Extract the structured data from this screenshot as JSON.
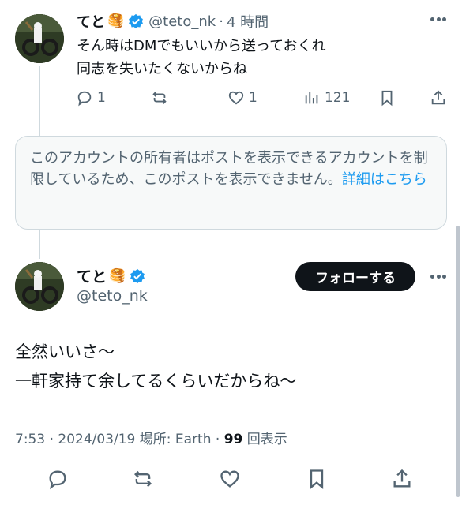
{
  "reply": {
    "name": "てと",
    "emoji": "🥞",
    "handle": "@teto_nk",
    "separator": "·",
    "time": "4 時間",
    "text_line1": "そん時はDMでもいいから送っておくれ",
    "text_line2": "同志を失いたくないからね",
    "reply_count": "1",
    "like_count": "1",
    "view_count": "121"
  },
  "notice": {
    "text": "このアカウントの所有者はポストを表示できるアカウントを制限しているため、このポストを表示できません。",
    "link": "詳細はこちら"
  },
  "main": {
    "name": "てと",
    "emoji": "🥞",
    "handle": "@teto_nk",
    "follow_label": "フォローする",
    "text_line1": "全然いいさ〜",
    "text_line2": "一軒家持て余してるくらいだからね〜",
    "timestamp": "7:53 · 2024/03/19",
    "location": "場所: Earth ·",
    "views": "99",
    "views_label": "回表示"
  },
  "colors": {
    "accent": "#1d9bf0",
    "text": "#0f1419",
    "muted": "#536471",
    "border": "#cfd9de"
  }
}
